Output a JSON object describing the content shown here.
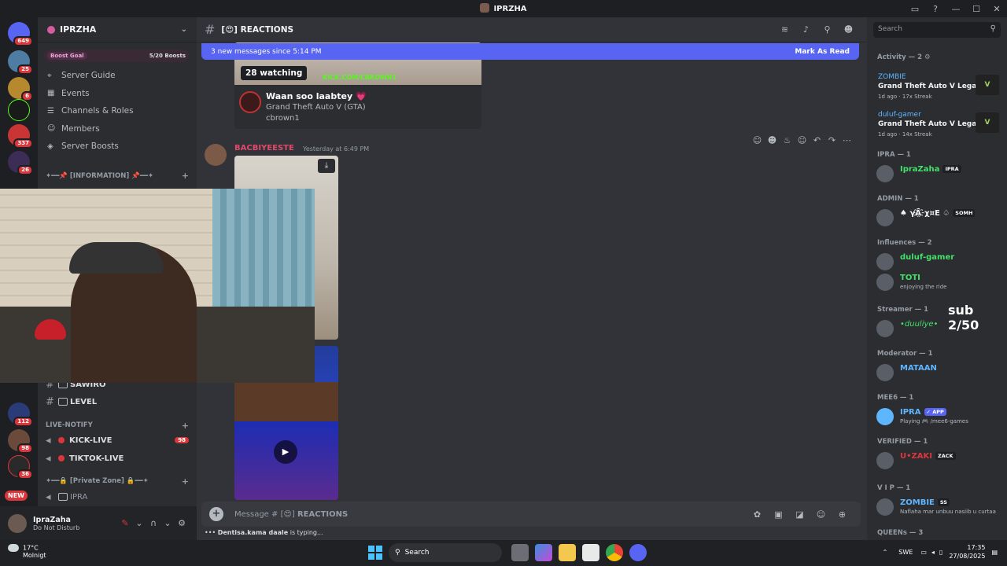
{
  "window": {
    "title": "IPRZHA"
  },
  "guild": {
    "name": "IPRZHA",
    "boost_label": "Boost Goal",
    "boost_count": "5/20 Boosts",
    "menu": [
      "Server Guide",
      "Events",
      "Channels & Roles",
      "Members",
      "Server Boosts"
    ],
    "info_category": "✦━━📌 [INFORMATION] 📌━━✦",
    "channels_top": [
      {
        "name": "SAWIRO"
      },
      {
        "name": "LEVEL"
      }
    ],
    "live_category": "LIVE-NOTIFY",
    "live_channels": [
      {
        "name": "KICK-LIVE",
        "badge": "98"
      },
      {
        "name": "TIKTOK-LIVE",
        "badge": ""
      }
    ],
    "private_category": "✦━━🔒 [Private Zone] 🔒━━✦",
    "private_channel": "IPRA"
  },
  "rail_badges": [
    "649",
    "25",
    "6",
    "337",
    "26",
    "112",
    "98",
    "36"
  ],
  "rail_new": "NEW",
  "user": {
    "name": "IpraZaha",
    "status": "Do Not Disturb"
  },
  "channel": {
    "name": "REACTIONS",
    "new_messages": "3 new messages since 5:14 PM",
    "mark_read": "Mark As Read"
  },
  "embed": {
    "watching": "28 watching",
    "kick_text": "KICK.COM/CBROWN1",
    "title": "Waan soo laabtey 💗",
    "game": "Grand Theft Auto V (GTA)",
    "user": "cbrown1"
  },
  "message": {
    "author": "BACBIYEESTE",
    "time": "Yesterday at 6:49 PM"
  },
  "composer": {
    "placeholder_prefix": "Message #",
    "placeholder_channel": "REACTIONS"
  },
  "typing": {
    "user": "Dentisa.kama daale",
    "suffix": "is typing..."
  },
  "members": {
    "search_placeholder": "Search",
    "activity_header": "Activity — 2",
    "activities": [
      {
        "user": "ZOMBIE",
        "game": "Grand Theft Auto V Legacy",
        "meta": "1d ago  ·  17x Streak",
        "logo": "V"
      },
      {
        "user": "duluf-gamer",
        "game": "Grand Theft Auto V Legacy",
        "meta": "1d ago  ·  14x Streak",
        "logo": "V"
      }
    ],
    "groups": [
      {
        "header": "IPRA — 1",
        "rows": [
          {
            "name": "IpraZaha",
            "tag": "IPRA",
            "sub": "",
            "color": "#43e06a"
          }
        ]
      },
      {
        "header": "ADMIN — 1",
        "rows": [
          {
            "name": "♠︎ γÃ҈χ¤E ♤",
            "tag": "SOMH",
            "sub": "",
            "color": "#f2f3f5"
          }
        ]
      },
      {
        "header": "Influences — 2",
        "rows": [
          {
            "name": "duluf-gamer",
            "tag": "",
            "sub": "",
            "color": "#43e06a"
          },
          {
            "name": "TOTI",
            "tag": "",
            "sub": "enjoying the ride",
            "color": "#43e06a"
          }
        ]
      },
      {
        "header": "Streamer — 1",
        "rows": [
          {
            "name": "•duuliye•",
            "tag": "",
            "sub": "",
            "color": "#43e06a"
          }
        ]
      },
      {
        "header": "Moderator — 1",
        "rows": [
          {
            "name": "MATAAN",
            "tag": "",
            "sub": "",
            "color": "#5eb6ff"
          }
        ]
      },
      {
        "header": "MEE6 — 1",
        "rows": [
          {
            "name": "IPRA",
            "tag": "✓ APP",
            "sub": "Playing 🎮 /mee6-games",
            "color": "#5eb6ff"
          }
        ]
      },
      {
        "header": "VERIFIED — 1",
        "rows": [
          {
            "name": "U•ZAKI",
            "tag": "ZACK",
            "sub": "",
            "color": "#da373c"
          }
        ]
      },
      {
        "header": "V I P — 1",
        "rows": [
          {
            "name": "ZOMBIE",
            "tag": "SS",
            "sub": "Naflaha mar unbuu nasiib u curtaa",
            "color": "#5eb6ff"
          }
        ]
      },
      {
        "header": "QUEENs — 3",
        "rows": []
      }
    ],
    "sub_overlay": "sub 2/50"
  },
  "taskbar": {
    "temperature": "17°C",
    "weather": "Molnigt",
    "search": "Search",
    "lang": "SWE",
    "time": "17:35",
    "date": "27/08/2025"
  }
}
